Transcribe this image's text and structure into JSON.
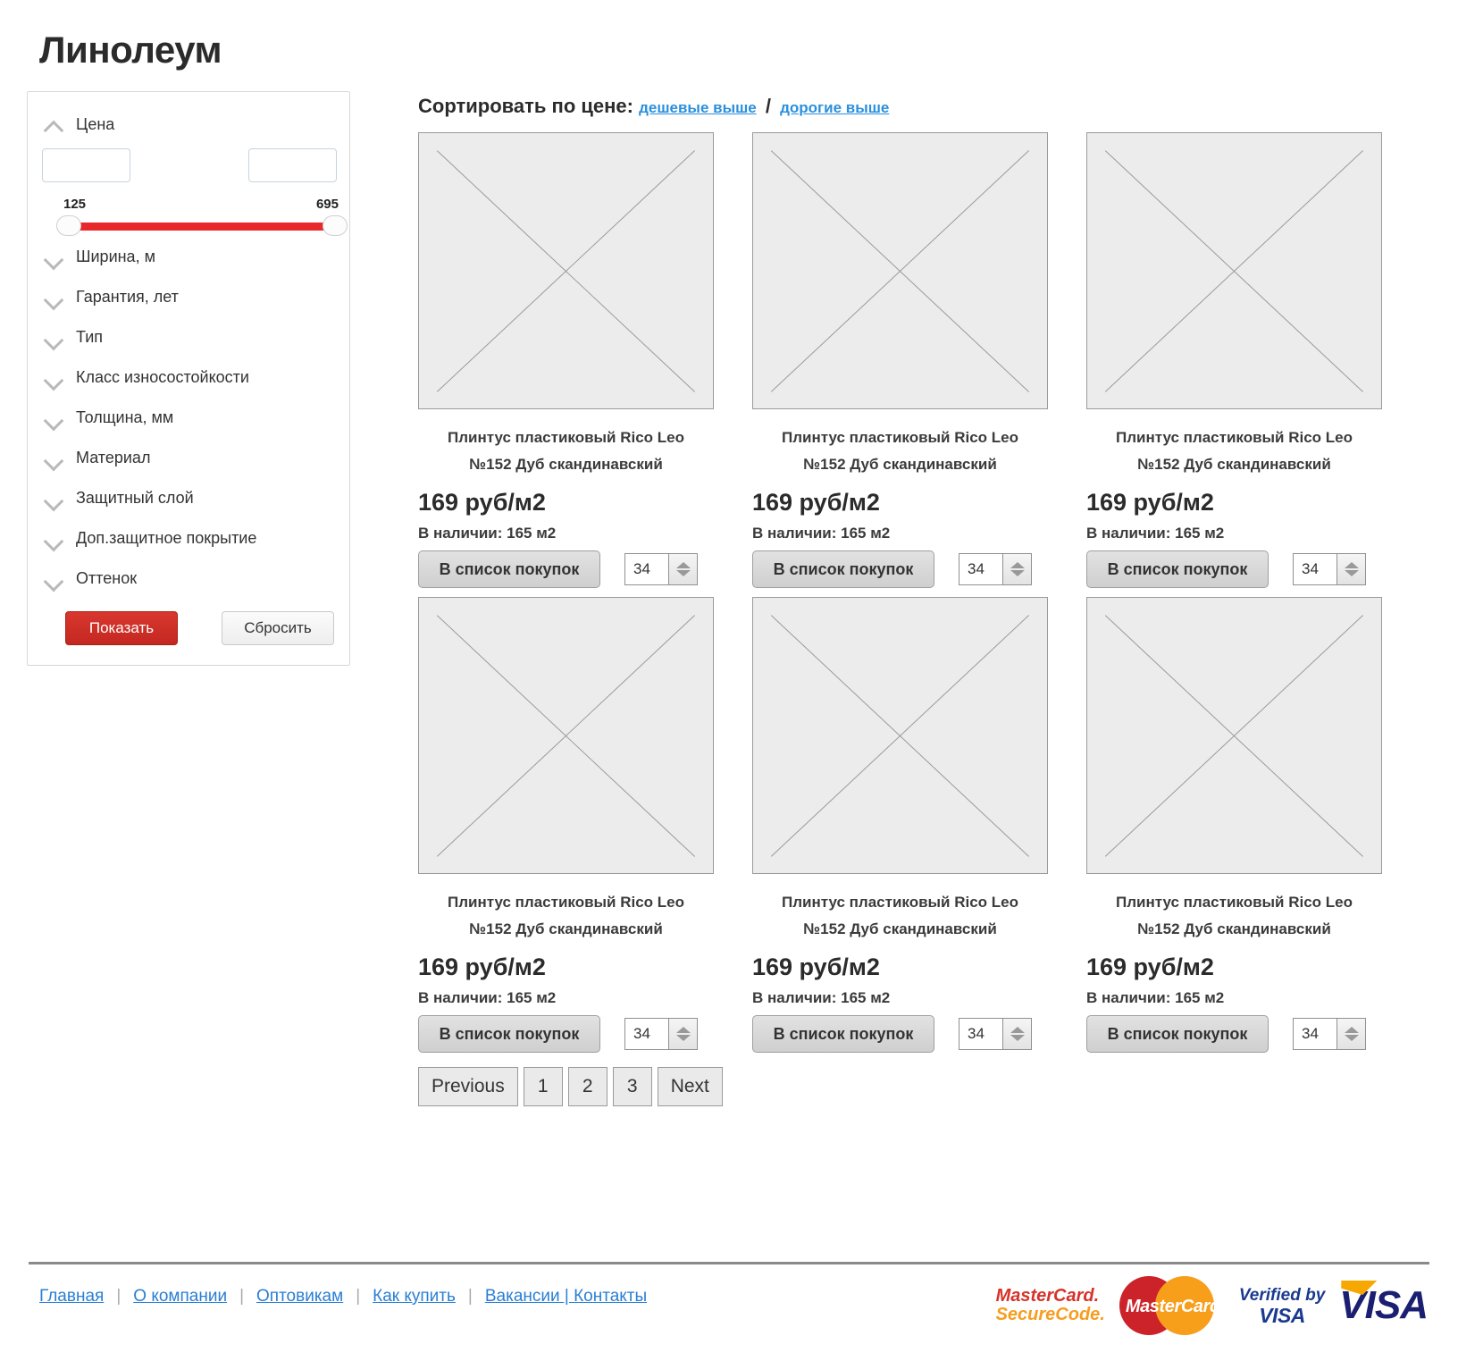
{
  "page": {
    "title": "Линолеум"
  },
  "sidebar": {
    "price_filter": {
      "label": "Цена",
      "min_value": "",
      "max_value": "",
      "min_placeholder": "",
      "max_placeholder": "",
      "range_min_label": "125",
      "range_max_label": "695",
      "track_color": "#e8282b"
    },
    "filters": [
      {
        "label": "Ширина, м"
      },
      {
        "label": "Гарантия, лет"
      },
      {
        "label": "Тип"
      },
      {
        "label": "Класс износостойкости"
      },
      {
        "label": "Толщина, мм"
      },
      {
        "label": "Материал"
      },
      {
        "label": "Защитный слой"
      },
      {
        "label": "Доп.защитное покрытие"
      },
      {
        "label": "Оттенок"
      }
    ],
    "show_button": "Показать",
    "reset_button": "Сбросить",
    "show_button_color": "#cf2e25"
  },
  "main": {
    "sort": {
      "label": "Сортировать по цене:",
      "cheap_first": "дешевые выше",
      "separator": "/",
      "expensive_first": "дорогие выше",
      "link_color": "#2a8fdd"
    },
    "products": [
      {
        "title_line1": "Плинтус пластиковый Rico Leo",
        "title_line2": "№152 Дуб скандинавский",
        "price": "169 руб/м2",
        "stock": "В наличии: 165 м2",
        "cart_button": "В список покупок",
        "quantity": "34"
      },
      {
        "title_line1": "Плинтус пластиковый Rico Leo",
        "title_line2": "№152 Дуб скандинавский",
        "price": "169 руб/м2",
        "stock": "В наличии: 165 м2",
        "cart_button": "В список покупок",
        "quantity": "34"
      },
      {
        "title_line1": "Плинтус пластиковый Rico Leo",
        "title_line2": "№152 Дуб скандинавский",
        "price": "169 руб/м2",
        "stock": "В наличии: 165 м2",
        "cart_button": "В список покупок",
        "quantity": "34"
      },
      {
        "title_line1": "Плинтус пластиковый Rico Leo",
        "title_line2": "№152 Дуб скандинавский",
        "price": "169 руб/м2",
        "stock": "В наличии: 165 м2",
        "cart_button": "В список покупок",
        "quantity": "34"
      },
      {
        "title_line1": "Плинтус пластиковый Rico Leo",
        "title_line2": "№152 Дуб скандинавский",
        "price": "169 руб/м2",
        "stock": "В наличии: 165 м2",
        "cart_button": "В список покупок",
        "quantity": "34"
      },
      {
        "title_line1": "Плинтус пластиковый Rico Leo",
        "title_line2": "№152 Дуб скандинавский",
        "price": "169 руб/м2",
        "stock": "В наличии: 165 м2",
        "cart_button": "В список покупок",
        "quantity": "34"
      }
    ],
    "pagination": [
      {
        "label": "Previous",
        "name": "previous"
      },
      {
        "label": "1",
        "name": "page-1"
      },
      {
        "label": "2",
        "name": "page-2"
      },
      {
        "label": "3",
        "name": "page-3"
      },
      {
        "label": "Next",
        "name": "next"
      }
    ]
  },
  "footer": {
    "links": [
      "Главная",
      "О компании",
      "Оптовикам",
      "Как купить",
      "Вакансии | Контакты"
    ],
    "payment": {
      "mastercard_secure_line1": "MasterCard.",
      "mastercard_secure_line2": "SecureCode.",
      "mastercard_label": "MasterCard",
      "verified_line1": "Verified by",
      "verified_line2": "VISA",
      "visa_label": "VISA"
    }
  }
}
